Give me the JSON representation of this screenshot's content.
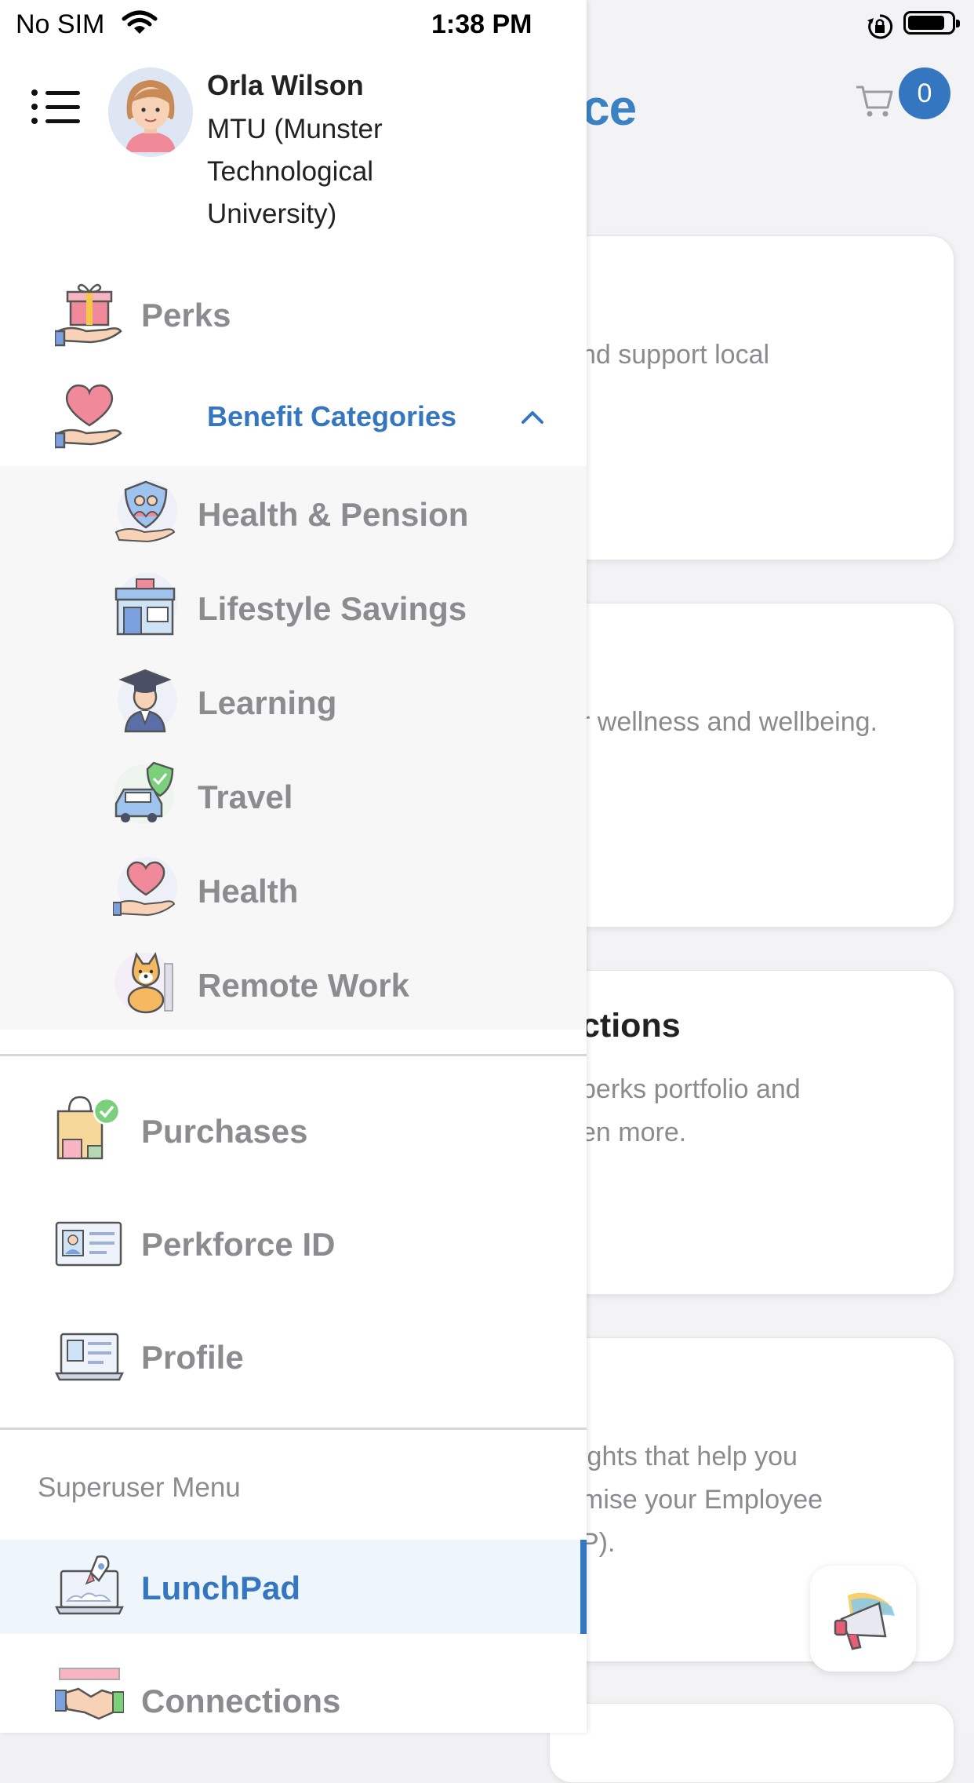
{
  "status_bar": {
    "carrier": "No SIM",
    "time": "1:38 PM"
  },
  "background": {
    "logo_fragment": "ce",
    "cart_count": "0",
    "cards": [
      {
        "title": "",
        "desc": [
          "nd support local"
        ]
      },
      {
        "title": "",
        "desc": [
          "r wellness and wellbeing."
        ]
      },
      {
        "title": "ctions",
        "desc": [
          "perks portfolio and",
          "en more."
        ]
      },
      {
        "title": "",
        "desc": [
          "ights that help you",
          "mise your Employee",
          "P)."
        ]
      }
    ]
  },
  "drawer": {
    "user": {
      "name": "Orla Wilson",
      "org": "MTU (Munster Technological University)"
    },
    "menu": {
      "perks": "Perks",
      "benefit_categories": "Benefit Categories",
      "categories": [
        {
          "label": "Health & Pension",
          "icon": "shield-family-icon"
        },
        {
          "label": "Lifestyle Savings",
          "icon": "storefront-icon"
        },
        {
          "label": "Learning",
          "icon": "graduate-icon"
        },
        {
          "label": "Travel",
          "icon": "car-shield-icon"
        },
        {
          "label": "Health",
          "icon": "heart-hand-icon"
        },
        {
          "label": "Remote Work",
          "icon": "dog-icon"
        }
      ],
      "purchases": "Purchases",
      "perkforce_id": "Perkforce ID",
      "profile": "Profile"
    },
    "superuser_label": "Superuser Menu",
    "superuser": {
      "lunchpad": "LunchPad",
      "connections": "Connections"
    }
  },
  "colors": {
    "accent": "#3477c0",
    "muted_text": "#8c8c90",
    "active_bg": "#eef5fb"
  }
}
